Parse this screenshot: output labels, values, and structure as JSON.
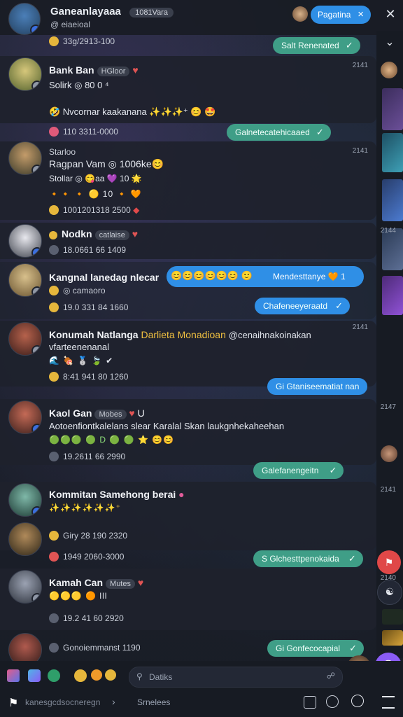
{
  "header": {
    "title": "Ganeanlayaaa",
    "title_tag": "1081Vara",
    "subtitle": "@ eiaeioal",
    "action_button": "Pagatina",
    "close": "×",
    "right_close": "✕",
    "right_chevron": "⌄"
  },
  "messages": [
    {
      "meta": "33g/2913-100",
      "pill": "Salt Renenated"
    },
    {
      "name": "Bank Ban",
      "tag": "HGloor",
      "time": "2141",
      "lines": [
        "Solirk ◎ 80 0 ⁴",
        "🤣 Nvcornar kaakanana ✨✨✨⁺ 😊 🤩"
      ],
      "meta": "110 3311-0000",
      "pill": "Galnetecatehicaaed"
    },
    {
      "name": "Starloo",
      "time": "2141",
      "lines": [
        "Ragpan Vam ◎ 1006ke😊",
        "Stollar ◎ 😋aa 💜 10 🌟",
        "🔸🔸 🔸 🟡 10 🔸 🧡"
      ],
      "meta": "1001201318 2500"
    },
    {
      "name": "Nodkn",
      "tag": "catlaise",
      "time": "2144",
      "meta": "18.0661 66 1409"
    },
    {
      "name": "Kangnal lanedag",
      "extra": "nlecar",
      "emojis": "😊😊😊😊😊😊 🙂",
      "meta1": "◎ camaoro",
      "meta": "19.0 331 84 1660",
      "bubble_top": "Mendesttanye 🧡 1",
      "bubble_bottom": "Chafeneeyeraatd"
    },
    {
      "name": "Konumah Natlanga",
      "name2": "Darlieta Monadioan",
      "handle": "@cenaihnakoinakan",
      "time": "2141",
      "lines": [
        "vfarteenenanal",
        "🌊 🍖 🥈 🍃 ✔"
      ],
      "meta": "8:41 941 80 1260",
      "pill": "Gi Gtaniseematiat nan"
    },
    {
      "name": "Kaol Gan",
      "tag": "Mobes",
      "extra": "U",
      "time": "2147",
      "lines": [
        "Aotoenfiontkalelans slear Karalal Skan laukgnhekaheehan",
        "🟢🟢🟢 🟢 D 🟢 🟢 ⭐ 😊😊"
      ],
      "meta": "19.2611 66 2990",
      "pill": "Galefanengeitn"
    },
    {
      "name": "Kommitan Samehong berai",
      "time": "2141",
      "lines": [
        "✨✨✨✨✨✨⁺"
      ],
      "meta1": "Giry 28 190 2320",
      "meta": "1949 2060-3000",
      "pill": "S Glchesttpenokaida"
    },
    {
      "name": "Kamah Can",
      "tag": "Mutes",
      "time": "2140",
      "lines": [
        "🟡🟡🟡 🟠 lll"
      ],
      "meta": "19.2 41 60 2920"
    },
    {
      "meta": "Gonoiemmanst 1190",
      "pill": "Gi Gonfecocapial"
    }
  ],
  "composer": {
    "search_placeholder": "Datiks",
    "input_placeholder": "Srnelees",
    "left_text": "kanesgcdsocneregn"
  },
  "colors": {
    "accent": "#2f8fe6",
    "pill_green": "#3f9e87",
    "fab_purple": "#8a5cf6",
    "fab_red": "#e04848"
  }
}
